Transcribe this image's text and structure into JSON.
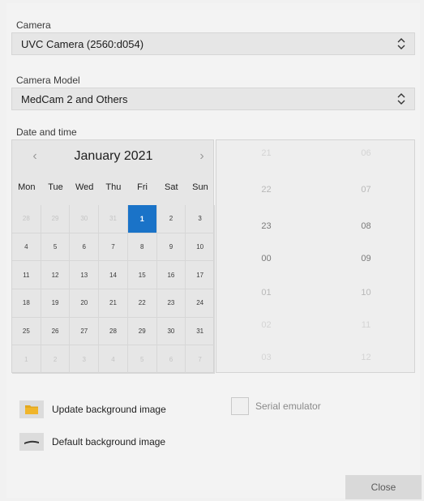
{
  "camera": {
    "label": "Camera",
    "selected": "UVC Camera (2560:d054)"
  },
  "camera_model": {
    "label": "Camera Model",
    "selected": "MedCam 2 and Others"
  },
  "datetime": {
    "label": "Date and time",
    "calendar": {
      "month_title": "January 2021",
      "prev_glyph": "‹",
      "next_glyph": "›",
      "weekdays": [
        "Mon",
        "Tue",
        "Wed",
        "Thu",
        "Fri",
        "Sat",
        "Sun"
      ],
      "weeks": [
        [
          "28",
          "29",
          "30",
          "31",
          "1",
          "2",
          "3"
        ],
        [
          "4",
          "5",
          "6",
          "7",
          "8",
          "9",
          "10"
        ],
        [
          "11",
          "12",
          "13",
          "14",
          "15",
          "16",
          "17"
        ],
        [
          "18",
          "19",
          "20",
          "21",
          "22",
          "23",
          "24"
        ],
        [
          "25",
          "26",
          "27",
          "28",
          "29",
          "30",
          "31"
        ],
        [
          "1",
          "2",
          "3",
          "4",
          "5",
          "6",
          "7"
        ]
      ],
      "selected_day": "1"
    },
    "time": {
      "hours": [
        "21",
        "22",
        "23",
        "00",
        "01",
        "02",
        "03"
      ],
      "minutes": [
        "06",
        "07",
        "08",
        "09",
        "10",
        "11",
        "12"
      ]
    }
  },
  "actions": {
    "update_bg": "Update background image",
    "default_bg": "Default background image",
    "serial_emulator": "Serial emulator",
    "close": "Close"
  },
  "colors": {
    "accent": "#1a73c8",
    "folder_icon": "#e2a81f"
  }
}
